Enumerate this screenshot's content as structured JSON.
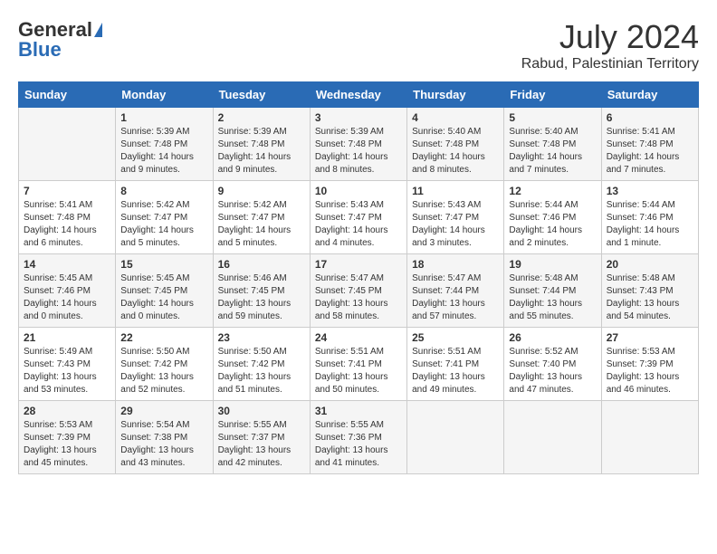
{
  "header": {
    "logo_general": "General",
    "logo_blue": "Blue",
    "month": "July 2024",
    "location": "Rabud, Palestinian Territory"
  },
  "columns": [
    "Sunday",
    "Monday",
    "Tuesday",
    "Wednesday",
    "Thursday",
    "Friday",
    "Saturday"
  ],
  "weeks": [
    [
      {
        "day": "",
        "info": ""
      },
      {
        "day": "1",
        "info": "Sunrise: 5:39 AM\nSunset: 7:48 PM\nDaylight: 14 hours\nand 9 minutes."
      },
      {
        "day": "2",
        "info": "Sunrise: 5:39 AM\nSunset: 7:48 PM\nDaylight: 14 hours\nand 9 minutes."
      },
      {
        "day": "3",
        "info": "Sunrise: 5:39 AM\nSunset: 7:48 PM\nDaylight: 14 hours\nand 8 minutes."
      },
      {
        "day": "4",
        "info": "Sunrise: 5:40 AM\nSunset: 7:48 PM\nDaylight: 14 hours\nand 8 minutes."
      },
      {
        "day": "5",
        "info": "Sunrise: 5:40 AM\nSunset: 7:48 PM\nDaylight: 14 hours\nand 7 minutes."
      },
      {
        "day": "6",
        "info": "Sunrise: 5:41 AM\nSunset: 7:48 PM\nDaylight: 14 hours\nand 7 minutes."
      }
    ],
    [
      {
        "day": "7",
        "info": "Sunrise: 5:41 AM\nSunset: 7:48 PM\nDaylight: 14 hours\nand 6 minutes."
      },
      {
        "day": "8",
        "info": "Sunrise: 5:42 AM\nSunset: 7:47 PM\nDaylight: 14 hours\nand 5 minutes."
      },
      {
        "day": "9",
        "info": "Sunrise: 5:42 AM\nSunset: 7:47 PM\nDaylight: 14 hours\nand 5 minutes."
      },
      {
        "day": "10",
        "info": "Sunrise: 5:43 AM\nSunset: 7:47 PM\nDaylight: 14 hours\nand 4 minutes."
      },
      {
        "day": "11",
        "info": "Sunrise: 5:43 AM\nSunset: 7:47 PM\nDaylight: 14 hours\nand 3 minutes."
      },
      {
        "day": "12",
        "info": "Sunrise: 5:44 AM\nSunset: 7:46 PM\nDaylight: 14 hours\nand 2 minutes."
      },
      {
        "day": "13",
        "info": "Sunrise: 5:44 AM\nSunset: 7:46 PM\nDaylight: 14 hours\nand 1 minute."
      }
    ],
    [
      {
        "day": "14",
        "info": "Sunrise: 5:45 AM\nSunset: 7:46 PM\nDaylight: 14 hours\nand 0 minutes."
      },
      {
        "day": "15",
        "info": "Sunrise: 5:45 AM\nSunset: 7:45 PM\nDaylight: 14 hours\nand 0 minutes."
      },
      {
        "day": "16",
        "info": "Sunrise: 5:46 AM\nSunset: 7:45 PM\nDaylight: 13 hours\nand 59 minutes."
      },
      {
        "day": "17",
        "info": "Sunrise: 5:47 AM\nSunset: 7:45 PM\nDaylight: 13 hours\nand 58 minutes."
      },
      {
        "day": "18",
        "info": "Sunrise: 5:47 AM\nSunset: 7:44 PM\nDaylight: 13 hours\nand 57 minutes."
      },
      {
        "day": "19",
        "info": "Sunrise: 5:48 AM\nSunset: 7:44 PM\nDaylight: 13 hours\nand 55 minutes."
      },
      {
        "day": "20",
        "info": "Sunrise: 5:48 AM\nSunset: 7:43 PM\nDaylight: 13 hours\nand 54 minutes."
      }
    ],
    [
      {
        "day": "21",
        "info": "Sunrise: 5:49 AM\nSunset: 7:43 PM\nDaylight: 13 hours\nand 53 minutes."
      },
      {
        "day": "22",
        "info": "Sunrise: 5:50 AM\nSunset: 7:42 PM\nDaylight: 13 hours\nand 52 minutes."
      },
      {
        "day": "23",
        "info": "Sunrise: 5:50 AM\nSunset: 7:42 PM\nDaylight: 13 hours\nand 51 minutes."
      },
      {
        "day": "24",
        "info": "Sunrise: 5:51 AM\nSunset: 7:41 PM\nDaylight: 13 hours\nand 50 minutes."
      },
      {
        "day": "25",
        "info": "Sunrise: 5:51 AM\nSunset: 7:41 PM\nDaylight: 13 hours\nand 49 minutes."
      },
      {
        "day": "26",
        "info": "Sunrise: 5:52 AM\nSunset: 7:40 PM\nDaylight: 13 hours\nand 47 minutes."
      },
      {
        "day": "27",
        "info": "Sunrise: 5:53 AM\nSunset: 7:39 PM\nDaylight: 13 hours\nand 46 minutes."
      }
    ],
    [
      {
        "day": "28",
        "info": "Sunrise: 5:53 AM\nSunset: 7:39 PM\nDaylight: 13 hours\nand 45 minutes."
      },
      {
        "day": "29",
        "info": "Sunrise: 5:54 AM\nSunset: 7:38 PM\nDaylight: 13 hours\nand 43 minutes."
      },
      {
        "day": "30",
        "info": "Sunrise: 5:55 AM\nSunset: 7:37 PM\nDaylight: 13 hours\nand 42 minutes."
      },
      {
        "day": "31",
        "info": "Sunrise: 5:55 AM\nSunset: 7:36 PM\nDaylight: 13 hours\nand 41 minutes."
      },
      {
        "day": "",
        "info": ""
      },
      {
        "day": "",
        "info": ""
      },
      {
        "day": "",
        "info": ""
      }
    ]
  ]
}
